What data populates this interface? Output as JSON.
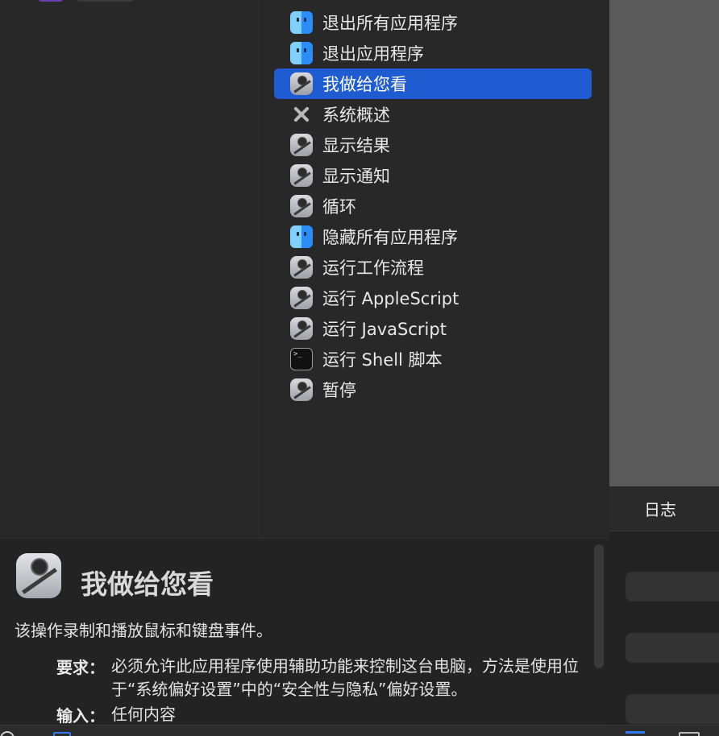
{
  "actions": [
    {
      "label": "退出所有应用程序",
      "icon": "finder-icon"
    },
    {
      "label": "退出应用程序",
      "icon": "finder-icon"
    },
    {
      "label": "我做给您看",
      "icon": "automator-icon",
      "selected": true
    },
    {
      "label": "系统概述",
      "icon": "tools-icon"
    },
    {
      "label": "显示结果",
      "icon": "automator-icon"
    },
    {
      "label": "显示通知",
      "icon": "automator-icon"
    },
    {
      "label": "循环",
      "icon": "automator-icon"
    },
    {
      "label": "隐藏所有应用程序",
      "icon": "finder-icon"
    },
    {
      "label": "运行工作流程",
      "icon": "automator-icon"
    },
    {
      "label": "运行 AppleScript",
      "icon": "automator-icon"
    },
    {
      "label": "运行 JavaScript",
      "icon": "automator-icon"
    },
    {
      "label": "运行 Shell 脚本",
      "icon": "terminal-icon"
    },
    {
      "label": "暂停",
      "icon": "automator-icon"
    }
  ],
  "terminal_glyph": ">_",
  "log": {
    "title": "日志"
  },
  "description": {
    "title": "我做给您看",
    "summary": "该操作录制和播放鼠标和键盘事件。",
    "requires_label": "要求：",
    "requires_text": "必须允许此应用程序使用辅助功能来控制这台电脑，方法是使用位于“系统偏好设置”中的“安全性与隐私”偏好设置。",
    "input_label": "输入：",
    "input_text": "任何内容"
  },
  "colors": {
    "selection": "#1f5bd1",
    "accent": "#2f7bf0"
  }
}
